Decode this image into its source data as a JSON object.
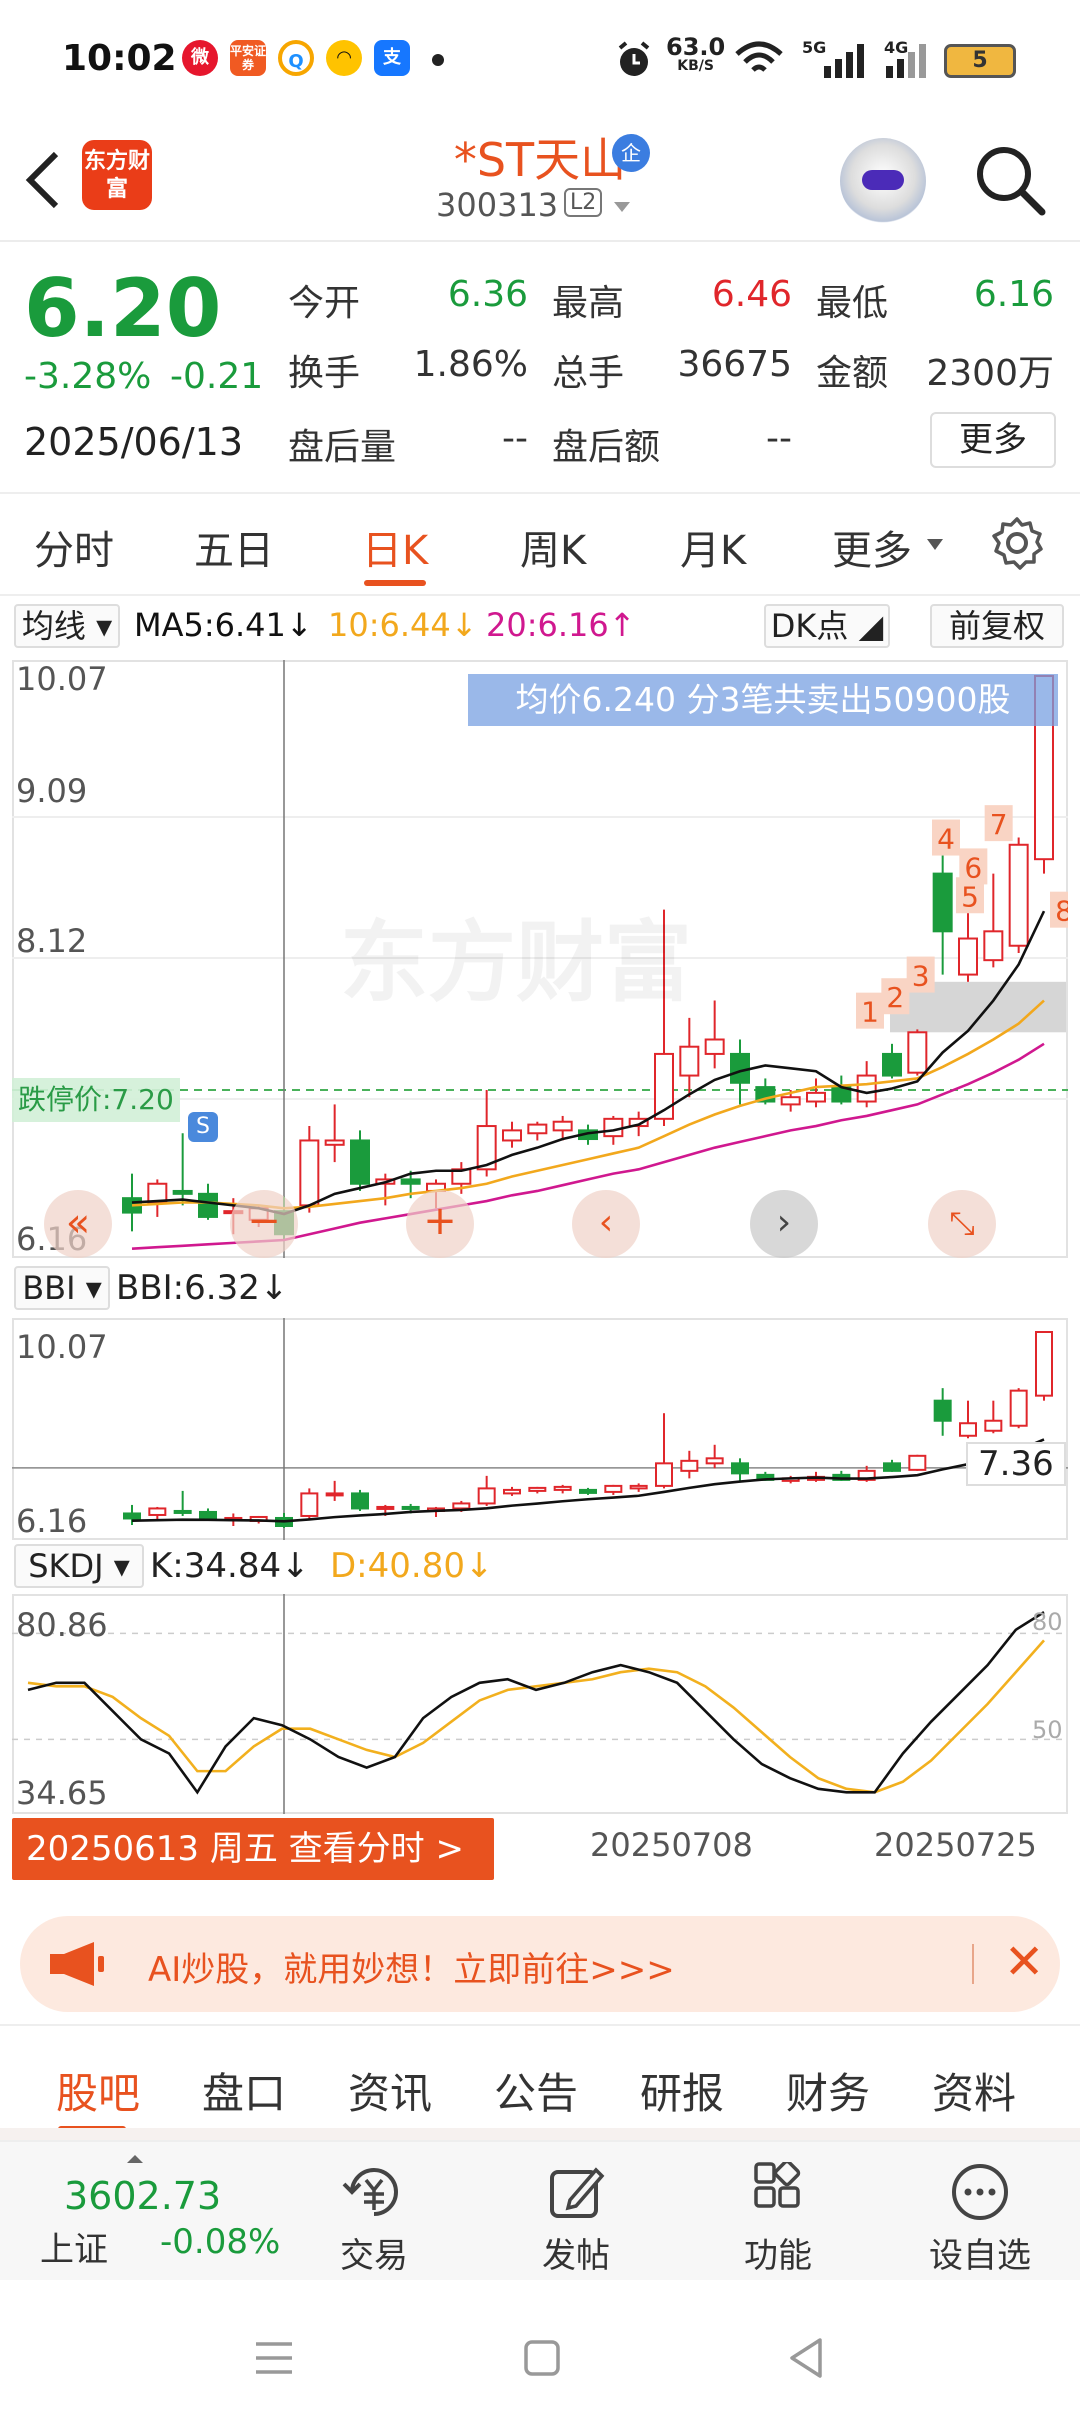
{
  "status_bar": {
    "time": "10:02",
    "net_speed": "63.0",
    "net_unit": "KB/S",
    "signal_1": "5G",
    "signal_2": "4G",
    "battery": "5",
    "pingan_label": "平安证券"
  },
  "header": {
    "app_logo": "东方财富",
    "stock_name": "*ST天山",
    "badge": "企",
    "stock_code": "300313",
    "level": "L2"
  },
  "quote": {
    "price": "6.20",
    "change_pct": "-3.28%",
    "change": "-0.21",
    "date": "2025/06/13",
    "open_label": "今开",
    "open": "6.36",
    "high_label": "最高",
    "high": "6.46",
    "low_label": "最低",
    "low": "6.16",
    "turnover_label": "换手",
    "turnover": "1.86%",
    "volume_label": "总手",
    "volume": "36675",
    "amount_label": "金额",
    "amount": "2300万",
    "after_vol_label": "盘后量",
    "after_vol": "--",
    "after_amt_label": "盘后额",
    "after_amt": "--",
    "more": "更多"
  },
  "tabs": [
    "分时",
    "五日",
    "日K",
    "周K",
    "月K",
    "更多"
  ],
  "active_tab": "日K",
  "ma_bar": {
    "selector": "均线",
    "ma5": "MA5:6.41↓",
    "ma10": "10:6.44↓",
    "ma20": "20:6.16↑",
    "dk": "DK点",
    "adjust": "前复权",
    "colors": {
      "ma5": "#111111",
      "ma10": "#f2a81d",
      "ma20": "#d0188f"
    }
  },
  "main_chart": {
    "y_top": "10.07",
    "y_2": "9.09",
    "y_3": "8.12",
    "y_bottom": "6.16",
    "tooltip": "均价6.240  分3笔共卖出50900股",
    "limit_label": "跌停价:7.20",
    "watermark": "东方财富",
    "markers": [
      "1",
      "2",
      "3",
      "4",
      "5",
      "6",
      "7",
      "8"
    ],
    "s_marker": "S"
  },
  "chart_data": {
    "type": "candlestick",
    "ylim": [
      6.16,
      10.07
    ],
    "candles": [
      {
        "o": 6.45,
        "h": 6.62,
        "l": 6.22,
        "c": 6.35
      },
      {
        "o": 6.42,
        "h": 6.58,
        "l": 6.32,
        "c": 6.55
      },
      {
        "o": 6.5,
        "h": 6.9,
        "l": 6.4,
        "c": 6.48
      },
      {
        "o": 6.48,
        "h": 6.55,
        "l": 6.3,
        "c": 6.32
      },
      {
        "o": 6.35,
        "h": 6.45,
        "l": 6.2,
        "c": 6.36
      },
      {
        "o": 6.3,
        "h": 6.4,
        "l": 6.25,
        "c": 6.38
      },
      {
        "o": 6.36,
        "h": 6.46,
        "l": 6.16,
        "c": 6.2
      },
      {
        "o": 6.4,
        "h": 6.95,
        "l": 6.35,
        "c": 6.85
      },
      {
        "o": 6.82,
        "h": 7.1,
        "l": 6.7,
        "c": 6.85
      },
      {
        "o": 6.85,
        "h": 6.92,
        "l": 6.5,
        "c": 6.55
      },
      {
        "o": 6.55,
        "h": 6.62,
        "l": 6.4,
        "c": 6.58
      },
      {
        "o": 6.58,
        "h": 6.64,
        "l": 6.45,
        "c": 6.55
      },
      {
        "o": 6.5,
        "h": 6.58,
        "l": 6.38,
        "c": 6.55
      },
      {
        "o": 6.55,
        "h": 6.7,
        "l": 6.48,
        "c": 6.65
      },
      {
        "o": 6.65,
        "h": 7.2,
        "l": 6.6,
        "c": 6.95
      },
      {
        "o": 6.85,
        "h": 6.98,
        "l": 6.8,
        "c": 6.92
      },
      {
        "o": 6.9,
        "h": 6.98,
        "l": 6.85,
        "c": 6.96
      },
      {
        "o": 6.92,
        "h": 7.02,
        "l": 6.85,
        "c": 6.98
      },
      {
        "o": 6.92,
        "h": 6.96,
        "l": 6.82,
        "c": 6.86
      },
      {
        "o": 6.88,
        "h": 7.02,
        "l": 6.82,
        "c": 7.0
      },
      {
        "o": 6.95,
        "h": 7.05,
        "l": 6.88,
        "c": 7.0
      },
      {
        "o": 7.0,
        "h": 8.45,
        "l": 6.95,
        "c": 7.45
      },
      {
        "o": 7.3,
        "h": 7.7,
        "l": 7.15,
        "c": 7.5
      },
      {
        "o": 7.45,
        "h": 7.82,
        "l": 7.35,
        "c": 7.55
      },
      {
        "o": 7.45,
        "h": 7.55,
        "l": 7.1,
        "c": 7.25
      },
      {
        "o": 7.22,
        "h": 7.28,
        "l": 7.1,
        "c": 7.12
      },
      {
        "o": 7.1,
        "h": 7.2,
        "l": 7.05,
        "c": 7.15
      },
      {
        "o": 7.12,
        "h": 7.28,
        "l": 7.08,
        "c": 7.18
      },
      {
        "o": 7.22,
        "h": 7.3,
        "l": 7.1,
        "c": 7.12
      },
      {
        "o": 7.12,
        "h": 7.4,
        "l": 7.08,
        "c": 7.3
      },
      {
        "o": 7.45,
        "h": 7.52,
        "l": 7.28,
        "c": 7.3
      },
      {
        "o": 7.32,
        "h": 7.62,
        "l": 7.3,
        "c": 7.6
      },
      {
        "o": 8.7,
        "h": 8.95,
        "l": 8.0,
        "c": 8.3
      },
      {
        "o": 8.0,
        "h": 8.7,
        "l": 7.95,
        "c": 8.25
      },
      {
        "o": 8.1,
        "h": 8.7,
        "l": 8.05,
        "c": 8.3
      },
      {
        "o": 8.2,
        "h": 8.95,
        "l": 8.15,
        "c": 8.9
      },
      {
        "o": 8.8,
        "h": 10.07,
        "l": 8.7,
        "c": 10.07
      }
    ],
    "ma5": [
      6.42,
      6.43,
      6.44,
      6.42,
      6.4,
      6.38,
      6.34,
      6.4,
      6.48,
      6.52,
      6.56,
      6.62,
      6.64,
      6.64,
      6.68,
      6.75,
      6.8,
      6.86,
      6.9,
      6.92,
      6.96,
      7.06,
      7.17,
      7.27,
      7.33,
      7.37,
      7.35,
      7.33,
      7.22,
      7.18,
      7.21,
      7.26,
      7.46,
      7.61,
      7.82,
      8.07,
      8.44
    ],
    "ma10": [
      6.4,
      6.41,
      6.42,
      6.42,
      6.41,
      6.4,
      6.38,
      6.39,
      6.41,
      6.43,
      6.45,
      6.48,
      6.5,
      6.52,
      6.55,
      6.6,
      6.64,
      6.68,
      6.72,
      6.76,
      6.8,
      6.88,
      6.96,
      7.03,
      7.09,
      7.14,
      7.18,
      7.22,
      7.23,
      7.24,
      7.26,
      7.28,
      7.36,
      7.45,
      7.55,
      7.66,
      7.82
    ],
    "ma20": [
      6.1,
      6.11,
      6.12,
      6.13,
      6.14,
      6.15,
      6.16,
      6.2,
      6.24,
      6.28,
      6.31,
      6.34,
      6.37,
      6.4,
      6.43,
      6.47,
      6.5,
      6.54,
      6.58,
      6.62,
      6.65,
      6.7,
      6.75,
      6.8,
      6.84,
      6.88,
      6.92,
      6.95,
      6.99,
      7.02,
      7.06,
      7.1,
      7.17,
      7.24,
      7.32,
      7.41,
      7.52
    ],
    "limit_price": 7.2,
    "bbi": {
      "label": "BBI",
      "value_text": "BBI:6.32↓",
      "y_top": "10.07",
      "y_bottom": "6.16",
      "last": "7.36"
    },
    "kdj": {
      "label": "SKDJ",
      "k_text": "K:34.84↓",
      "d_text": "D:40.80↓",
      "y_top": "80.86",
      "y_bottom": "34.65",
      "ref_top": "80",
      "ref_mid": "50",
      "k": [
        64,
        66,
        66,
        58,
        50,
        46,
        35,
        48,
        56,
        54,
        50,
        45,
        42,
        45,
        56,
        62,
        66,
        67,
        64,
        66,
        69,
        71,
        69,
        66,
        58,
        50,
        43,
        39,
        36,
        35,
        35,
        46,
        55,
        63,
        71,
        81,
        86
      ],
      "d": [
        66,
        65,
        65,
        62,
        56,
        51,
        41,
        41,
        48,
        53,
        53,
        50,
        47,
        45,
        49,
        55,
        61,
        64,
        65,
        66,
        67,
        69,
        70,
        69,
        65,
        59,
        52,
        45,
        39,
        36,
        35,
        38,
        44,
        52,
        60,
        69,
        78
      ]
    },
    "x_dates": [
      "20250708",
      "20250725"
    ],
    "selected_label": "20250613 周五 查看分时 >"
  },
  "ai_banner": {
    "text": "AI炒股，就用妙想！立即前往>>>",
    "close": "✕"
  },
  "sub_tabs": [
    "股吧",
    "盘口",
    "资讯",
    "公告",
    "研报",
    "财务",
    "资料"
  ],
  "bottom_nav": {
    "index_value": "3602.73",
    "index_name": "上证",
    "index_change": "-0.08%",
    "items": [
      "交易",
      "发帖",
      "功能",
      "设自选"
    ]
  }
}
